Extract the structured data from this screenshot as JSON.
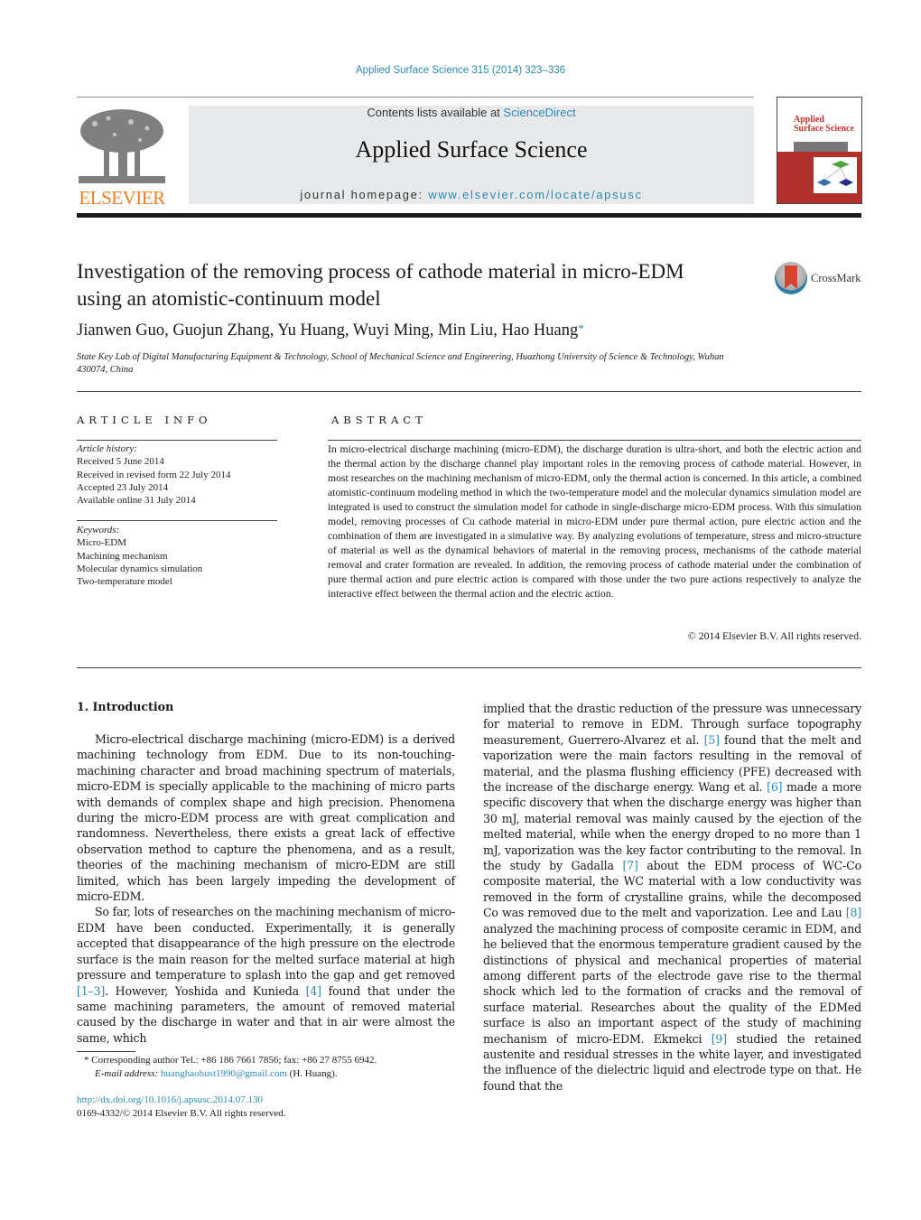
{
  "header": {
    "citation": "Applied Surface Science 315 (2014) 323–336",
    "contents_prefix": "Contents lists available at ",
    "contents_link": "ScienceDirect",
    "journal_name": "Applied Surface Science",
    "homepage_prefix": "journal homepage: ",
    "homepage_link": "www.elsevier.com/locate/apsusc",
    "publisher_logo_text": "ELSEVIER",
    "cover_title_line1": "Applied",
    "cover_title_line2": "Surface Science"
  },
  "article": {
    "title": "Investigation of the removing process of cathode material in micro-EDM using an atomistic-continuum model",
    "crossmark_label": "CrossMark",
    "authors": "Jianwen Guo, Guojun Zhang, Yu Huang, Wuyi Ming, Min Liu, Hao Huang",
    "corresponding_marker": "*",
    "affiliation": "State Key Lab of Digital Manufacturing Equipment & Technology, School of Mechanical Science and Engineering, Huazhong University of Science & Technology, Wuhan 430074, China"
  },
  "article_info": {
    "label": "ARTICLE INFO",
    "history_heading": "Article history:",
    "history": [
      "Received 5 June 2014",
      "Received in revised form 22 July 2014",
      "Accepted 23 July 2014",
      "Available online 31 July 2014"
    ],
    "keywords_heading": "Keywords:",
    "keywords": [
      "Micro-EDM",
      "Machining mechanism",
      "Molecular dynamics simulation",
      "Two-temperature model"
    ]
  },
  "abstract": {
    "label": "ABSTRACT",
    "text": "In micro-electrical discharge machining (micro-EDM), the discharge duration is ultra-short, and both the electric action and the thermal action by the discharge channel play important roles in the removing process of cathode material. However, in most researches on the machining mechanism of micro-EDM, only the thermal action is concerned. In this article, a combined atomistic-continuum modeling method in which the two-temperature model and the molecular dynamics simulation model are integrated is used to construct the simulation model for cathode in single-discharge micro-EDM process. With this simulation model, removing processes of Cu cathode material in micro-EDM under pure thermal action, pure electric action and the combination of them are investigated in a simulative way. By analyzing evolutions of temperature, stress and micro-structure of material as well as the dynamical behaviors of material in the removing process, mechanisms of the cathode material removal and crater formation are revealed. In addition, the removing process of cathode material under the combination of pure thermal action and pure electric action is compared with those under the two pure actions respectively to analyze the interactive effect between the thermal action and the electric action.",
    "copyright": "© 2014 Elsevier B.V. All rights reserved."
  },
  "introduction": {
    "heading": "1.  Introduction",
    "p1": "Micro-electrical discharge machining (micro-EDM) is a derived machining technology from EDM. Due to its non-touching-machining character and broad machining spectrum of materials, micro-EDM is specially applicable to the machining of micro parts with demands of complex shape and high precision. Phenomena during the micro-EDM process are with great complication and randomness. Nevertheless, there exists a great lack of effective observation method to capture the phenomena, and as a result, theories of the machining mechanism of micro-EDM are still limited, which has been largely impeding the development of micro-EDM.",
    "p2_a": "So far, lots of researches on the machining mechanism of micro-EDM have been conducted. Experimentally, it is generally accepted that disappearance of the high pressure on the electrode surface is the main reason for the melted surface material at high pressure and temperature to splash into the gap and get removed ",
    "ref_1_3": "[1–3]",
    "p2_b": ". However, Yoshida and Kunieda ",
    "ref_4": "[4]",
    "p2_c": " found that under the same machining parameters, the amount of removed material caused by the discharge in water and that in air were almost the same, which",
    "col2_a": "implied that the drastic reduction of the pressure was unnecessary for material to remove in EDM. Through surface topography measurement, Guerrero-Alvarez et al. ",
    "ref_5": "[5]",
    "col2_b": " found that the melt and vaporization were the main factors resulting in the removal of material, and the plasma flushing efficiency (PFE) decreased with the increase of the discharge energy. Wang et al. ",
    "ref_6": "[6]",
    "col2_c": " made a more specific discovery that when the discharge energy was higher than 30 mJ, material removal was mainly caused by the ejection of the melted material, while when the energy droped to no more than 1 mJ, vaporization was the key factor contributing to the removal. In the study by Gadalla ",
    "ref_7": "[7]",
    "col2_d": " about the EDM process of WC-Co composite material, the WC material with a low conductivity was removed in the form of crystalline grains, while the decomposed Co was removed due to the melt and vaporization. Lee and Lau ",
    "ref_8": "[8]",
    "col2_e": " analyzed the machining process of composite ceramic in EDM, and he believed that the enormous temperature gradient caused by the distinctions of physical and mechanical properties of material among different parts of the electrode gave rise to the thermal shock which led to the formation of cracks and the removal of surface material. Researches about the quality of the EDMed surface is also an important aspect of the study of machining mechanism of micro-EDM. Ekmekci ",
    "ref_9": "[9]",
    "col2_f": " studied the retained austenite and residual stresses in the white layer, and investigated the influence of the dielectric liquid and electrode type on that. He found that the"
  },
  "footnotes": {
    "marker": "*",
    "corresponding": " Corresponding author Tel.: +86 186 7661 7856; fax: +86 27 8755 6942.",
    "email_label": "E-mail address: ",
    "email": "huanghaohust1990@gmail.com",
    "email_suffix": " (H. Huang).",
    "doi": "http://dx.doi.org/10.1016/j.apsusc.2014.07.130",
    "issn": "0169-4332/© 2014 Elsevier B.V. All rights reserved."
  }
}
